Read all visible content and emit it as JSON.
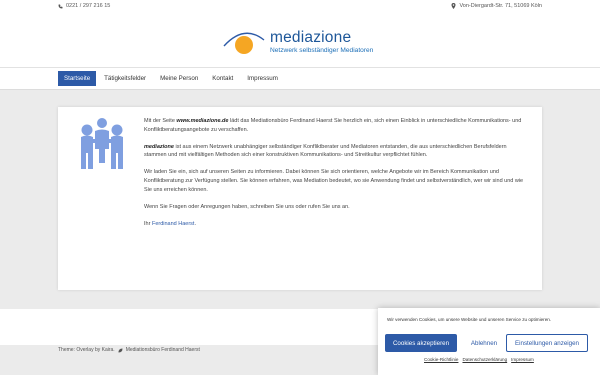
{
  "topbar": {
    "phone": "0221 / 297 216 15",
    "address": "Von-Diergardt-Str. 71, 51069 Köln"
  },
  "logo": {
    "title": "mediazione",
    "subtitle": "Netzwerk selbständiger Mediatoren"
  },
  "nav": {
    "items": [
      {
        "label": "Startseite",
        "active": true
      },
      {
        "label": "Tätigkeitsfelder",
        "active": false
      },
      {
        "label": "Meine Person",
        "active": false
      },
      {
        "label": "Kontakt",
        "active": false
      },
      {
        "label": "Impressum",
        "active": false
      }
    ]
  },
  "content": {
    "p1_pre": "Mit der Seite ",
    "p1_site": "www.mediazione.de",
    "p1_post": " lädt das Mediationsbüro Ferdinand Haerst Sie herzlich ein, sich einen Einblick in unterschiedliche Kommunikations- und Konfliktberatungsangebote zu verschaffen.",
    "p2_name": "mediazione",
    "p2_post": " ist aus einem Netzwerk unabhängiger selbständiger Konfliktberater und Mediatoren entstanden, die aus unterschiedlichen Berufsfeldern stammen und mit vielfältigen Methoden sich einer konstruktiven Kommunikations- und Streitkultur verpflichtet fühlen.",
    "p3": "Wir laden Sie ein, sich auf unseren Seiten zu informieren. Dabei können Sie sich orientieren, welche Angebote wir im Bereich Kommunikation und Konfliktberatung zur Verfügung stellen. Sie können erfahren, was Mediation bedeutet, wo sie Anwendung findet und selbstverständlich, wer wir sind und wie Sie uns erreichen können.",
    "p4": "Wenn Sie Fragen oder Anregungen haben, schreiben Sie uns oder rufen Sie uns an.",
    "sign_pre": "Ihr ",
    "sign_link": "Ferdinand Haerst",
    "sign_post": "."
  },
  "footer": {
    "theme": "Theme: Overlay by Kaira.",
    "owner": "Mediationsbüro Ferdinand Haerst"
  },
  "cookie": {
    "message": "Wir verwenden Cookies, um unsere Website und unseren Service zu optimieren.",
    "accept": "Cookies akzeptieren",
    "deny": "Ablehnen",
    "settings": "Einstellungen anzeigen",
    "links": [
      "Cookie-Richtlinie",
      "Datenschutzerklärung",
      "Impressum"
    ]
  },
  "colors": {
    "brand_blue": "#2d5aa7",
    "logo_orange": "#f5a623",
    "icon_blue": "#7f9fe0"
  },
  "icons": [
    "phone-icon",
    "map-pin-icon",
    "mediation-people-icon",
    "leaf-icon"
  ]
}
